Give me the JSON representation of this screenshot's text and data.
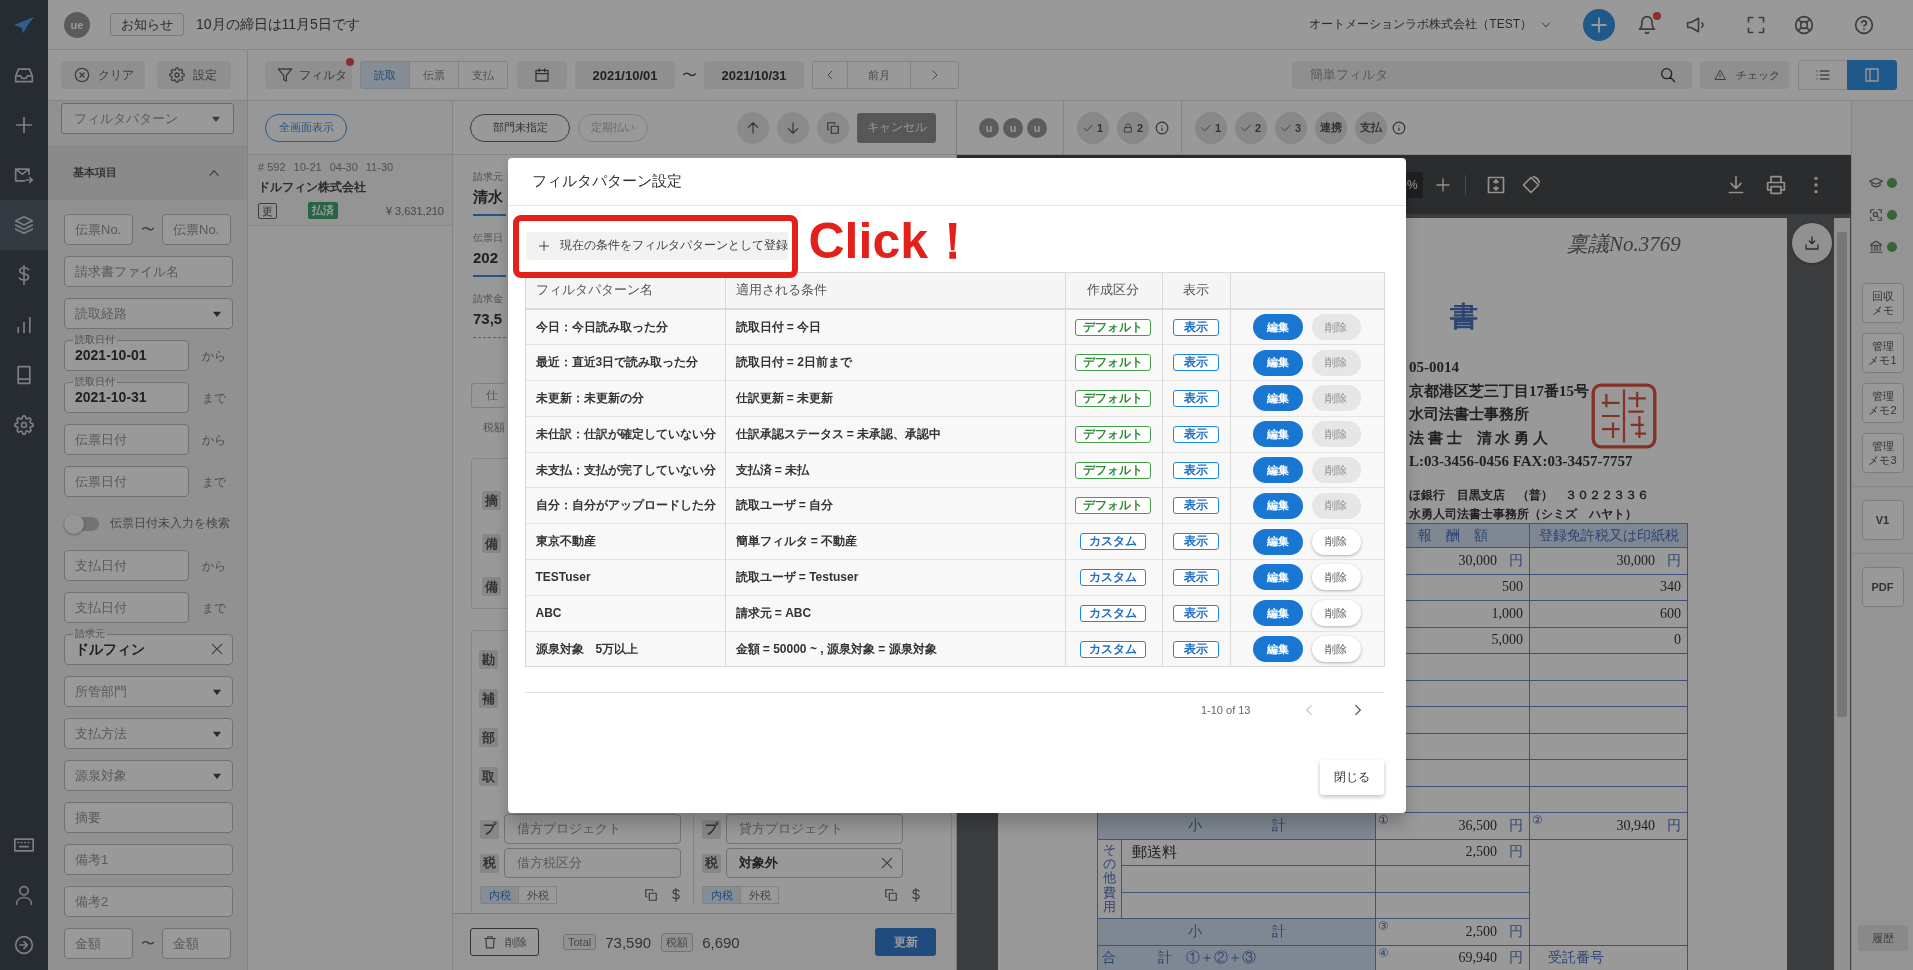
{
  "rail": {
    "items": [
      {
        "selected": false
      },
      {
        "selected": false
      },
      {
        "selected": false
      },
      {
        "selected": true
      },
      {
        "selected": false
      },
      {
        "selected": false
      },
      {
        "selected": false
      },
      {
        "selected": false
      }
    ]
  },
  "topbar": {
    "avatar": "ue",
    "notice_button": "お知らせ",
    "notice": "10月の締日は11月5日です",
    "company": "オートメーションラボ株式会社（TEST）",
    "unread": true
  },
  "toolbar": {
    "filter_button": "フィルタ",
    "filter_active": true,
    "source_tabs": [
      {
        "label": "読取",
        "selected": true
      },
      {
        "label": "伝票",
        "selected": false
      },
      {
        "label": "支払",
        "selected": false
      }
    ],
    "date_from": "2021/10/01",
    "date_separator": "〜",
    "date_to": "2021/10/31",
    "prev_month": "前月",
    "quick_filter": {
      "placeholder": "簡単フィルタ"
    },
    "check_button": "チェック",
    "view_modes": [
      {
        "selected": false
      },
      {
        "selected": true
      }
    ]
  },
  "filter_panel": {
    "clear_button": "クリア",
    "settings_button": "設定",
    "pattern_select": {
      "placeholder": "フィルタパターン"
    },
    "section": {
      "title": "基本項目",
      "expanded": true
    },
    "fields": [
      {
        "kind": "range",
        "from": {
          "placeholder": "伝票No."
        },
        "separator": "〜",
        "to": {
          "placeholder": "伝票No."
        }
      },
      {
        "kind": "text",
        "placeholder": "請求書ファイル名"
      },
      {
        "kind": "select",
        "placeholder": "読取経路"
      },
      {
        "kind": "text",
        "label": "読取日付",
        "value": "2021-10-01",
        "suffix": "から"
      },
      {
        "kind": "text",
        "label": "読取日付",
        "value": "2021-10-31",
        "suffix": "まで"
      },
      {
        "kind": "text",
        "placeholder": "伝票日付",
        "suffix": "から"
      },
      {
        "kind": "text",
        "placeholder": "伝票日付",
        "suffix": "まで"
      },
      {
        "kind": "toggle",
        "label": "伝票日付未入力を検索",
        "on": false
      },
      {
        "kind": "text",
        "placeholder": "支払日付",
        "suffix": "から"
      },
      {
        "kind": "text",
        "placeholder": "支払日付",
        "suffix": "まで"
      },
      {
        "kind": "text",
        "label": "請求元",
        "value": "ドルフィン",
        "clearable": true
      },
      {
        "kind": "select",
        "placeholder": "所管部門"
      },
      {
        "kind": "select",
        "placeholder": "支払方法"
      },
      {
        "kind": "select",
        "placeholder": "源泉対象"
      },
      {
        "kind": "text",
        "placeholder": "摘要"
      },
      {
        "kind": "text",
        "placeholder": "備考1"
      },
      {
        "kind": "text",
        "placeholder": "備考2"
      },
      {
        "kind": "range",
        "from": {
          "placeholder": "金額"
        },
        "separator": "〜",
        "to": {
          "placeholder": "金額"
        }
      }
    ]
  },
  "list": {
    "fullscreen_button": "全画面表示",
    "items": [
      {
        "number": "# 592",
        "dates": [
          "10-21",
          "04-30",
          "11-30"
        ],
        "company": "ドルフィン株式会社",
        "tag": "更",
        "status": "払済",
        "amount": "¥ 3,631,210"
      }
    ]
  },
  "detail": {
    "dept_button": "部門未指定",
    "recurring_button": {
      "label": "定期払い",
      "disabled": true
    },
    "cancel_button": "キャンセル",
    "summary": [
      {
        "kind": "field",
        "label": "請求元",
        "value": "清水"
      },
      {
        "kind": "field",
        "label": "伝票日",
        "value": "202"
      },
      {
        "kind": "readonly",
        "label": "請求金",
        "value": "73,5"
      }
    ],
    "journal_tab": "仕",
    "tax_label": "税額",
    "memo_tags": [
      "摘",
      "備",
      "備"
    ],
    "line_tags": [
      "勘",
      "補",
      "部",
      "取"
    ],
    "lines": [
      {
        "project_tag": "プ",
        "project": {
          "placeholder": "借方プロジェクト"
        },
        "tax_tag": "税",
        "tax": {
          "placeholder": "借方税区分"
        },
        "tax_modes": [
          {
            "label": "内税",
            "selected": true
          },
          {
            "label": "外税",
            "selected": false
          }
        ]
      },
      {
        "project_tag": "プ",
        "project": {
          "placeholder": "貸方プロジェクト"
        },
        "tax_tag": "税",
        "tax": {
          "value": "対象外",
          "clearable": true
        },
        "tax_modes": [
          {
            "label": "内税",
            "selected": true
          },
          {
            "label": "外税",
            "selected": false
          }
        ]
      }
    ],
    "footer": {
      "delete_button": "削除",
      "total_label": "Total",
      "total": "73,590",
      "tax_label": "税額",
      "tax": "6,690",
      "update_button": "更新"
    }
  },
  "viewer": {
    "approvers": [
      "u",
      "u",
      "u"
    ],
    "status_chips": [
      {
        "kind": "check",
        "label": "1"
      },
      {
        "kind": "lock",
        "label": "2"
      }
    ],
    "workflow_chips": [
      {
        "kind": "check",
        "label": "1"
      },
      {
        "kind": "check",
        "label": "2"
      },
      {
        "kind": "check",
        "label": "3"
      },
      {
        "kind": "text",
        "label": "連携"
      },
      {
        "kind": "text",
        "label": "支払"
      }
    ],
    "zoom_level": "%",
    "document": {
      "handwritten_note": "稟議No.3769",
      "title": "書",
      "address_lines": [
        "05-0014",
        "京都港区芝三丁目17番15号",
        "水司法書士事務所",
        "法 書 士　清 水 勇 人",
        "L:03-3456-0456 FAX:03-3457-7757"
      ],
      "bank_lines": [
        "ほ銀行　目黒支店　（普）　３０２２３３６",
        "水勇人司法書士事務所（シミズ　ハヤト）"
      ],
      "table": {
        "columns": [
          "報　酬　額",
          "登録免許税又は印紙税"
        ],
        "rows": [
          {
            "kind": "item",
            "fee": "30,000",
            "fee_unit": "円",
            "tax": "30,000",
            "tax_unit": "円"
          },
          {
            "kind": "item",
            "fee": "500",
            "tax": "340"
          },
          {
            "kind": "item",
            "fee": "1,000",
            "tax": "600"
          },
          {
            "kind": "item",
            "fee": "5,000",
            "tax": "0"
          },
          {
            "kind": "blank"
          },
          {
            "kind": "blank"
          },
          {
            "kind": "blank"
          },
          {
            "kind": "blank"
          },
          {
            "kind": "blank"
          },
          {
            "kind": "blank"
          },
          {
            "kind": "subtotal",
            "label": "小　　　　　計",
            "fee_mark": "①",
            "fee": "36,500",
            "fee_unit": "円",
            "tax_mark": "②",
            "tax": "30,940",
            "tax_unit": "円"
          },
          {
            "kind": "other",
            "group": "その他費用",
            "label": "郵送料",
            "fee": "2,500",
            "fee_unit": "円"
          },
          {
            "kind": "other"
          },
          {
            "kind": "other"
          },
          {
            "kind": "subtotal",
            "label": "小　　　　　計",
            "fee_mark": "③",
            "fee": "2,500",
            "fee_unit": "円"
          },
          {
            "kind": "total",
            "label": "合　　　計　①＋②＋③",
            "fee_mark": "④",
            "fee": "69,940",
            "fee_unit": "円",
            "tax": "受託番号"
          }
        ]
      }
    }
  },
  "side_tools": {
    "status": [
      {
        "on": true
      },
      {
        "on": true
      },
      {
        "on": true
      }
    ],
    "memo_buttons": [
      {
        "lines": [
          "回収",
          "メモ"
        ]
      },
      {
        "lines": [
          "管理",
          "メモ1"
        ]
      },
      {
        "lines": [
          "管理",
          "メモ2"
        ]
      },
      {
        "lines": [
          "管理",
          "メモ3"
        ]
      }
    ],
    "version_button": "V1",
    "pdf_button": "PDF",
    "history_button": "履歴"
  },
  "dialog": {
    "title": "フィルタパターン設定",
    "add_button": "現在の条件をフィルタパターンとして登録",
    "annotation": "Click！",
    "columns": [
      "フィルタパターン名",
      "適用される条件",
      "作成区分",
      "表示"
    ],
    "rows": [
      {
        "name": "今日：今日読み取った分",
        "condition": "読取日付 = 今日",
        "origin": {
          "kind": "default",
          "label": "デフォルト"
        },
        "visibility": "表示",
        "edit": "編集",
        "delete": {
          "label": "削除",
          "disabled": true
        }
      },
      {
        "name": "最近：直近3日で読み取った分",
        "condition": "読取日付 = 2日前まで",
        "origin": {
          "kind": "default",
          "label": "デフォルト"
        },
        "visibility": "表示",
        "edit": "編集",
        "delete": {
          "label": "削除",
          "disabled": true
        }
      },
      {
        "name": "未更新：未更新の分",
        "condition": "仕訳更新 = 未更新",
        "origin": {
          "kind": "default",
          "label": "デフォルト"
        },
        "visibility": "表示",
        "edit": "編集",
        "delete": {
          "label": "削除",
          "disabled": true
        }
      },
      {
        "name": "未仕訳：仕訳が確定していない分",
        "condition": "仕訳承認ステータス = 未承認、承認中",
        "origin": {
          "kind": "default",
          "label": "デフォルト"
        },
        "visibility": "表示",
        "edit": "編集",
        "delete": {
          "label": "削除",
          "disabled": true
        }
      },
      {
        "name": "未支払：支払が完了していない分",
        "condition": "支払済 = 未払",
        "origin": {
          "kind": "default",
          "label": "デフォルト"
        },
        "visibility": "表示",
        "edit": "編集",
        "delete": {
          "label": "削除",
          "disabled": true
        }
      },
      {
        "name": "自分：自分がアップロードした分",
        "condition": "読取ユーザ = 自分",
        "origin": {
          "kind": "default",
          "label": "デフォルト"
        },
        "visibility": "表示",
        "edit": "編集",
        "delete": {
          "label": "削除",
          "disabled": true
        }
      },
      {
        "name": "東京不動産",
        "condition": "簡単フィルタ = 不動産",
        "origin": {
          "kind": "custom",
          "label": "カスタム"
        },
        "visibility": "表示",
        "edit": "編集",
        "delete": {
          "label": "削除",
          "disabled": false
        }
      },
      {
        "name": "TESTuser",
        "condition": "読取ユーザ = Testuser",
        "origin": {
          "kind": "custom",
          "label": "カスタム"
        },
        "visibility": "表示",
        "edit": "編集",
        "delete": {
          "label": "削除",
          "disabled": false
        }
      },
      {
        "name": "ABC",
        "condition": "請求元 = ABC",
        "origin": {
          "kind": "custom",
          "label": "カスタム"
        },
        "visibility": "表示",
        "edit": "編集",
        "delete": {
          "label": "削除",
          "disabled": false
        }
      },
      {
        "name": "源泉対象　5万以上",
        "condition": "金額 = 50000 ~ , 源泉対象 = 源泉対象",
        "origin": {
          "kind": "custom",
          "label": "カスタム"
        },
        "visibility": "表示",
        "edit": "編集",
        "delete": {
          "label": "削除",
          "disabled": false
        }
      }
    ],
    "pagination": {
      "range": "1-10 of 13",
      "prev_disabled": true
    },
    "close_button": "閉じる"
  }
}
